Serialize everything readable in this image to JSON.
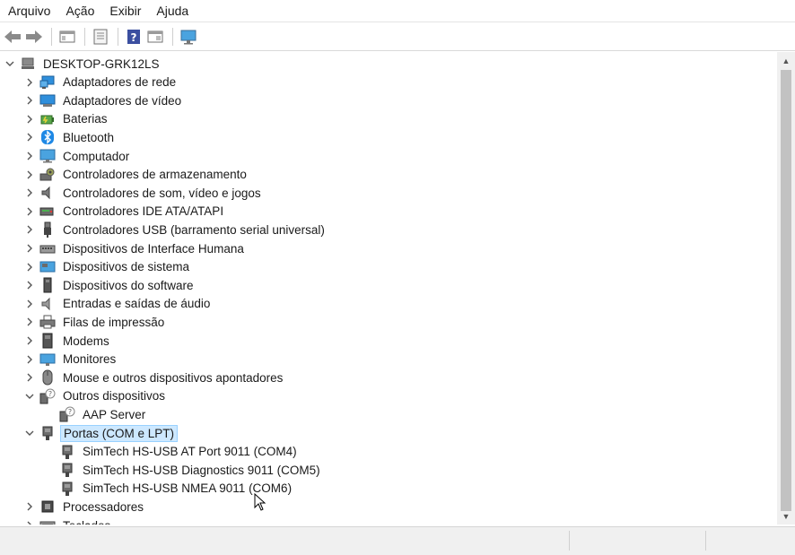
{
  "menu": [
    "Arquivo",
    "Ação",
    "Exibir",
    "Ajuda"
  ],
  "toolbar": {
    "buttons": [
      "back-icon",
      "forward-icon",
      "show-hide-tree-icon",
      "properties-icon",
      "help-icon",
      "view-icon",
      "monitor-icon"
    ]
  },
  "tree": {
    "root": "DESKTOP-GRK12LS",
    "items": [
      {
        "label": "Adaptadores de rede",
        "icon": "network-adapter-icon",
        "state": "collapsed"
      },
      {
        "label": "Adaptadores de vídeo",
        "icon": "display-adapter-icon",
        "state": "collapsed"
      },
      {
        "label": "Baterias",
        "icon": "battery-icon",
        "state": "collapsed"
      },
      {
        "label": "Bluetooth",
        "icon": "bluetooth-icon",
        "state": "collapsed"
      },
      {
        "label": "Computador",
        "icon": "computer-icon",
        "state": "collapsed"
      },
      {
        "label": "Controladores de armazenamento",
        "icon": "storage-controller-icon",
        "state": "collapsed"
      },
      {
        "label": "Controladores de som, vídeo e jogos",
        "icon": "speaker-icon",
        "state": "collapsed"
      },
      {
        "label": "Controladores IDE ATA/ATAPI",
        "icon": "ide-controller-icon",
        "state": "collapsed"
      },
      {
        "label": "Controladores USB (barramento serial universal)",
        "icon": "usb-icon",
        "state": "collapsed"
      },
      {
        "label": "Dispositivos de Interface Humana",
        "icon": "hid-icon",
        "state": "collapsed"
      },
      {
        "label": "Dispositivos de sistema",
        "icon": "system-device-icon",
        "state": "collapsed"
      },
      {
        "label": "Dispositivos do software",
        "icon": "software-device-icon",
        "state": "collapsed"
      },
      {
        "label": "Entradas e saídas de áudio",
        "icon": "audio-io-icon",
        "state": "collapsed"
      },
      {
        "label": "Filas de impressão",
        "icon": "printer-icon",
        "state": "collapsed"
      },
      {
        "label": "Modems",
        "icon": "modem-icon",
        "state": "collapsed"
      },
      {
        "label": "Monitores",
        "icon": "monitor-icon",
        "state": "collapsed"
      },
      {
        "label": "Mouse e outros dispositivos apontadores",
        "icon": "mouse-icon",
        "state": "collapsed"
      },
      {
        "label": "Outros dispositivos",
        "icon": "unknown-device-icon",
        "state": "expanded",
        "children": [
          {
            "label": "AAP Server",
            "icon": "unknown-device-icon"
          }
        ]
      },
      {
        "label": "Portas (COM e LPT)",
        "icon": "port-icon",
        "state": "expanded",
        "selected": true,
        "children": [
          {
            "label": "SimTech HS-USB AT Port 9011 (COM4)",
            "icon": "port-icon"
          },
          {
            "label": "SimTech HS-USB Diagnostics 9011 (COM5)",
            "icon": "port-icon"
          },
          {
            "label": "SimTech HS-USB NMEA 9011 (COM6)",
            "icon": "port-icon"
          }
        ]
      },
      {
        "label": "Processadores",
        "icon": "processor-icon",
        "state": "collapsed"
      },
      {
        "label": "Teclados",
        "icon": "keyboard-icon",
        "state": "collapsed"
      }
    ]
  },
  "colors": {
    "selection_bg": "#cde8ff",
    "selection_border": "#99d1ff",
    "accent_blue": "#1e88e5"
  }
}
